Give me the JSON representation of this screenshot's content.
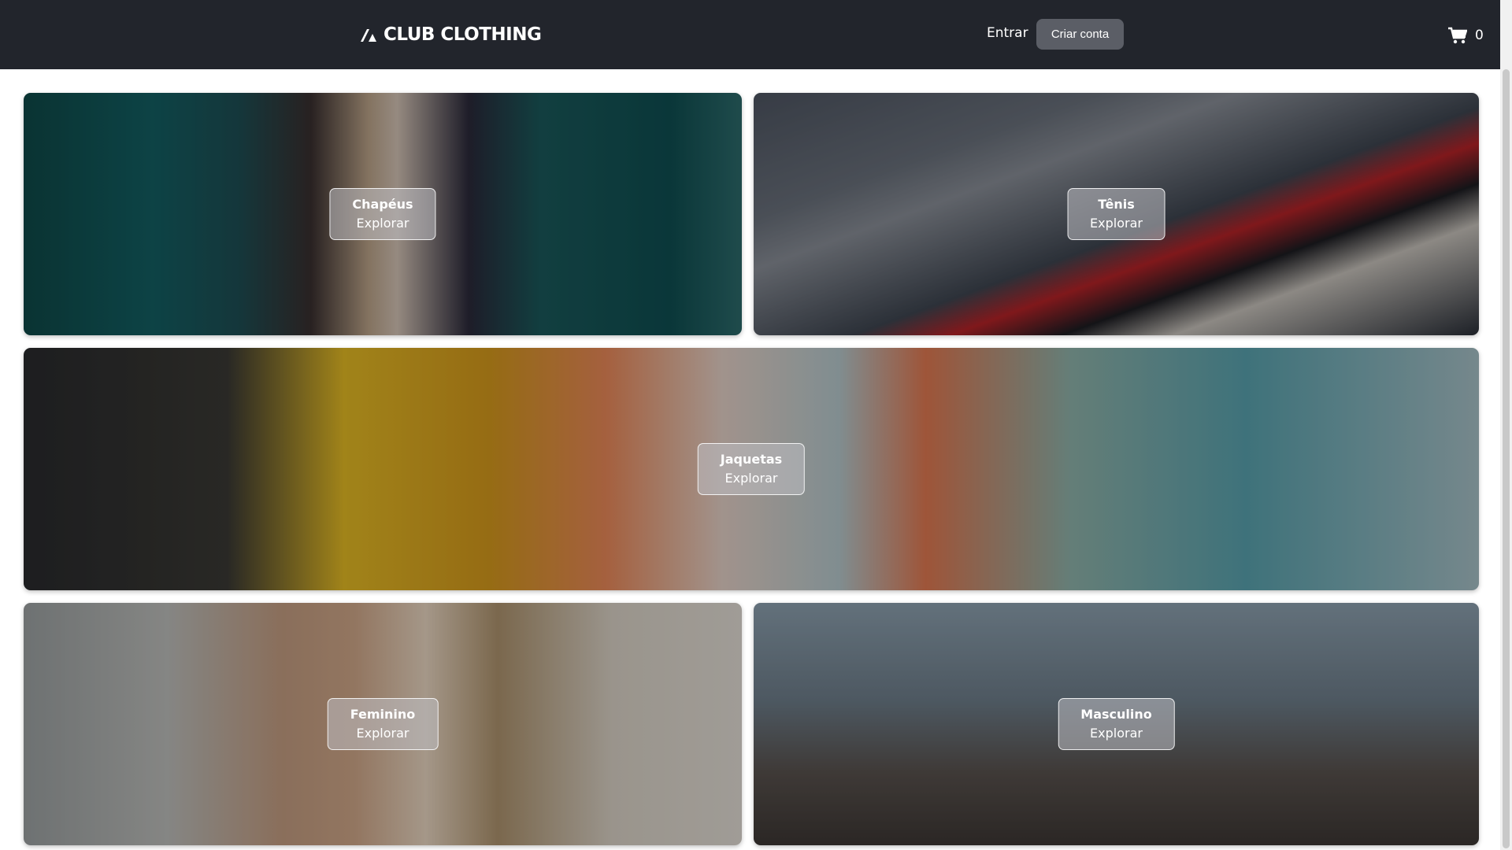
{
  "header": {
    "brand": "CLUB CLOTHING",
    "sign_in_label": "Entrar",
    "create_account_label": "Criar conta",
    "cart_count": "0"
  },
  "categories": [
    {
      "title": "Chapéus",
      "action": "Explorar"
    },
    {
      "title": "Tênis",
      "action": "Explorar"
    },
    {
      "title": "Jaquetas",
      "action": "Explorar"
    },
    {
      "title": "Feminino",
      "action": "Explorar"
    },
    {
      "title": "Masculino",
      "action": "Explorar"
    }
  ],
  "colors": {
    "header_bg": "#22252c",
    "button_bg": "#5b5e66"
  }
}
